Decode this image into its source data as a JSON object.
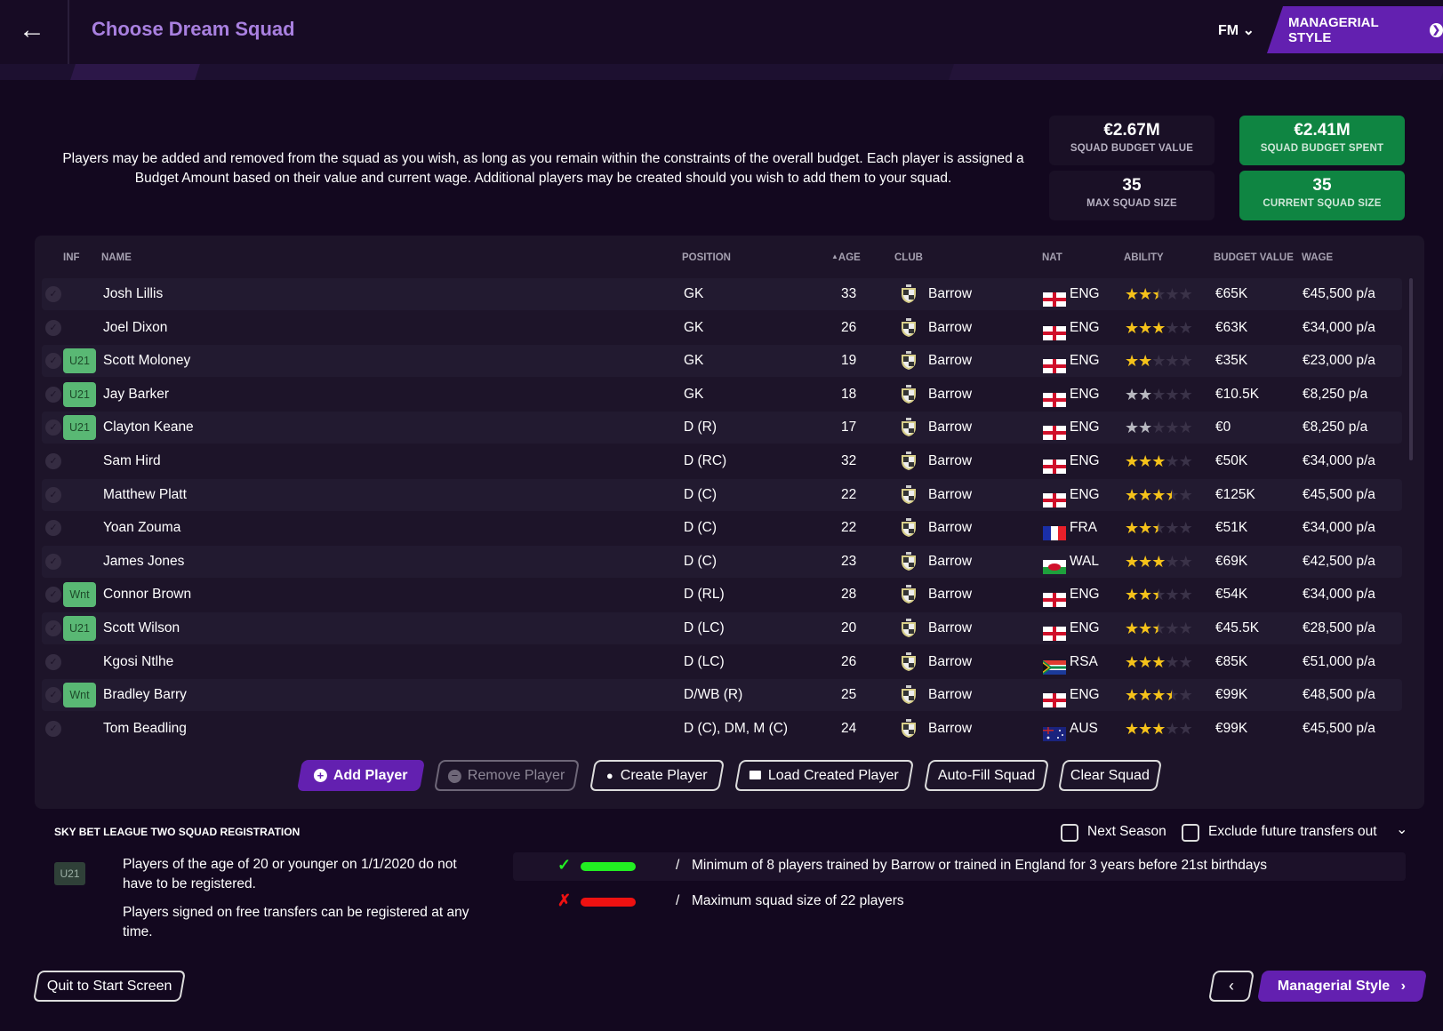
{
  "header": {
    "title": "Choose Dream Squad",
    "fm_menu": "FM",
    "next_screen": "MANAGERIAL STYLE"
  },
  "intro": "Players may be added and removed from the squad as you wish, as long as you remain within the constraints of the overall budget. Each player is assigned a Budget Amount based on their value and current wage. Additional players may be created should you wish to add them to your squad.",
  "stats": {
    "budget_value": {
      "value": "€2.67M",
      "label": "SQUAD BUDGET VALUE"
    },
    "budget_spent": {
      "value": "€2.41M",
      "label": "SQUAD BUDGET SPENT"
    },
    "max_size": {
      "value": "35",
      "label": "MAX SQUAD SIZE"
    },
    "current_size": {
      "value": "35",
      "label": "CURRENT SQUAD SIZE"
    }
  },
  "table": {
    "columns": {
      "inf": "INF",
      "name": "NAME",
      "position": "POSITION",
      "age": "AGE",
      "club": "CLUB",
      "nat": "NAT",
      "ability": "ABILITY",
      "budget_value": "BUDGET VALUE",
      "wage": "WAGE"
    },
    "sort_indicator": "▲",
    "rows": [
      {
        "badge": "",
        "name": "Josh Lillis",
        "position": "GK",
        "age": "33",
        "club": "Barrow",
        "nat": "ENG",
        "stars": 2.5,
        "star_color": "gold",
        "value": "€65K",
        "wage": "€45,500 p/a"
      },
      {
        "badge": "",
        "name": "Joel Dixon",
        "position": "GK",
        "age": "26",
        "club": "Barrow",
        "nat": "ENG",
        "stars": 3,
        "star_color": "gold",
        "value": "€63K",
        "wage": "€34,000 p/a"
      },
      {
        "badge": "U21",
        "name": "Scott Moloney",
        "position": "GK",
        "age": "19",
        "club": "Barrow",
        "nat": "ENG",
        "stars": 2,
        "star_color": "gold",
        "value": "€35K",
        "wage": "€23,000 p/a"
      },
      {
        "badge": "U21",
        "name": "Jay Barker",
        "position": "GK",
        "age": "18",
        "club": "Barrow",
        "nat": "ENG",
        "stars": 2,
        "star_color": "silver",
        "value": "€10.5K",
        "wage": "€8,250 p/a"
      },
      {
        "badge": "U21",
        "name": "Clayton Keane",
        "position": "D (R)",
        "age": "17",
        "club": "Barrow",
        "nat": "ENG",
        "stars": 2,
        "star_color": "silver",
        "value": "€0",
        "wage": "€8,250 p/a"
      },
      {
        "badge": "",
        "name": "Sam Hird",
        "position": "D (RC)",
        "age": "32",
        "club": "Barrow",
        "nat": "ENG",
        "stars": 3,
        "star_color": "gold",
        "value": "€50K",
        "wage": "€34,000 p/a"
      },
      {
        "badge": "",
        "name": "Matthew Platt",
        "position": "D (C)",
        "age": "22",
        "club": "Barrow",
        "nat": "ENG",
        "stars": 3.5,
        "star_color": "gold",
        "value": "€125K",
        "wage": "€45,500 p/a"
      },
      {
        "badge": "",
        "name": "Yoan Zouma",
        "position": "D (C)",
        "age": "22",
        "club": "Barrow",
        "nat": "FRA",
        "stars": 2.5,
        "star_color": "gold",
        "value": "€51K",
        "wage": "€34,000 p/a"
      },
      {
        "badge": "",
        "name": "James Jones",
        "position": "D (C)",
        "age": "23",
        "club": "Barrow",
        "nat": "WAL",
        "stars": 3,
        "star_color": "gold",
        "value": "€69K",
        "wage": "€42,500 p/a"
      },
      {
        "badge": "Wnt",
        "name": "Connor Brown",
        "position": "D (RL)",
        "age": "28",
        "club": "Barrow",
        "nat": "ENG",
        "stars": 2.5,
        "star_color": "gold",
        "value": "€54K",
        "wage": "€34,000 p/a"
      },
      {
        "badge": "U21",
        "name": "Scott Wilson",
        "position": "D (LC)",
        "age": "20",
        "club": "Barrow",
        "nat": "ENG",
        "stars": 2.5,
        "star_color": "gold",
        "value": "€45.5K",
        "wage": "€28,500 p/a"
      },
      {
        "badge": "",
        "name": "Kgosi Ntlhe",
        "position": "D (LC)",
        "age": "26",
        "club": "Barrow",
        "nat": "RSA",
        "stars": 3,
        "star_color": "gold",
        "value": "€85K",
        "wage": "€51,000 p/a"
      },
      {
        "badge": "Wnt",
        "name": "Bradley Barry",
        "position": "D/WB (R)",
        "age": "25",
        "club": "Barrow",
        "nat": "ENG",
        "stars": 3.5,
        "star_color": "gold",
        "value": "€99K",
        "wage": "€48,500 p/a"
      },
      {
        "badge": "",
        "name": "Tom Beadling",
        "position": "D (C), DM, M (C)",
        "age": "24",
        "club": "Barrow",
        "nat": "AUS",
        "stars": 3,
        "star_color": "gold",
        "value": "€99K",
        "wage": "€45,500 p/a"
      }
    ]
  },
  "actions": {
    "add": "Add Player",
    "remove": "Remove Player",
    "create": "Create Player",
    "load": "Load Created Player",
    "autofill": "Auto-Fill Squad",
    "clear": "Clear Squad"
  },
  "registration": {
    "title": "SKY BET LEAGUE TWO SQUAD REGISTRATION",
    "badge": "U21",
    "note1": "Players of the age of 20 or younger on 1/1/2020 do not have to be registered.",
    "note2": "Players signed on free transfers can be registered at any time.",
    "next_season": "Next Season",
    "exclude": "Exclude future transfers out",
    "rules": [
      {
        "status": "pass",
        "separator": "/",
        "text": "Minimum of 8 players trained by Barrow or trained in England for 3 years before 21st birthdays",
        "color": "#22ee22"
      },
      {
        "status": "fail",
        "separator": "/",
        "text": "Maximum squad size of 22 players",
        "color": "#ee1111"
      }
    ]
  },
  "footer": {
    "quit": "Quit to Start Screen",
    "prev": "‹",
    "next": "Managerial Style"
  }
}
